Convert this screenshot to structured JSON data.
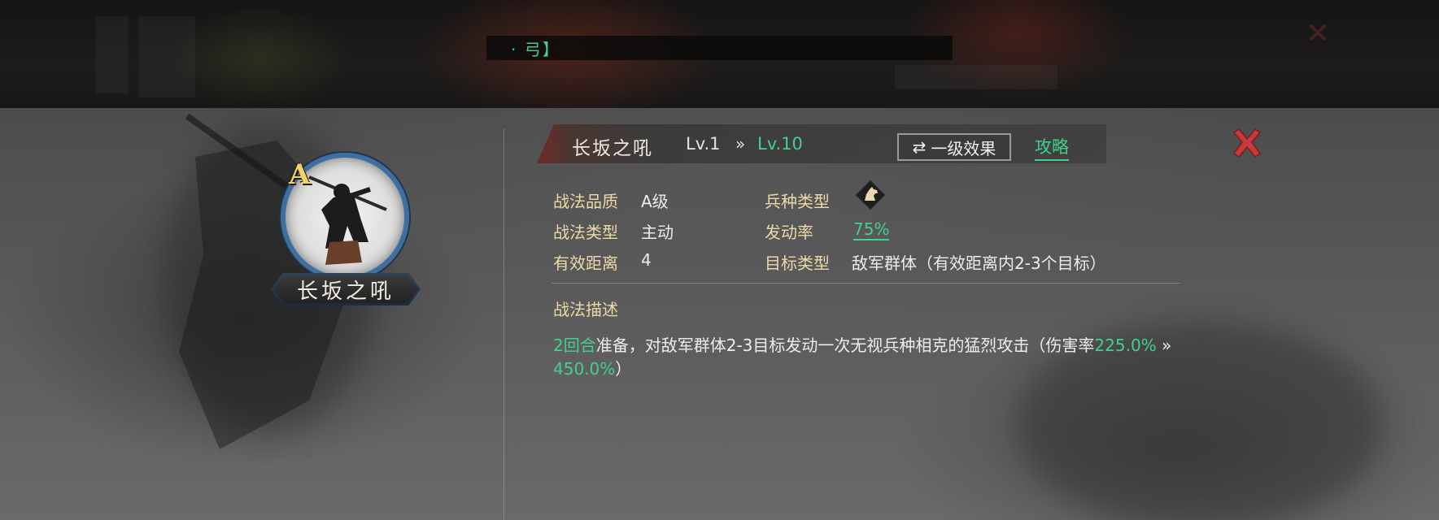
{
  "background_header": {
    "title": "· 弓】"
  },
  "skill": {
    "grade_badge": "A",
    "name": "长坂之吼",
    "level_from": "Lv.1",
    "level_arrow": "»",
    "level_to": "Lv.10"
  },
  "header": {
    "level_toggle_label": "一级效果",
    "guide_label": "攻略"
  },
  "attributes": {
    "quality_label": "战法品质",
    "quality_value": "A级",
    "type_label": "战法类型",
    "type_value": "主动",
    "range_label": "有效距离",
    "range_value": "4",
    "troop_label": "兵种类型",
    "troop_icon": "cavalry-horse-icon",
    "rate_label": "发动率",
    "rate_value": "75%",
    "target_label": "目标类型",
    "target_value": "敌军群体（有效距离内2-3个目标）"
  },
  "description": {
    "title": "战法描述",
    "part1": "2回合",
    "part2": "准备，对敌军群体2-3目标发动一次无视兵种相克的猛烈攻击（伤害率",
    "part3": "225.0%",
    "part4": " » ",
    "part5": "450.0%",
    "part6": "）"
  },
  "colors": {
    "accent_green": "#43d08d",
    "label_gold": "#ecd9a8",
    "close_red": "#c8393a",
    "badge_gold": "#f3d26b",
    "ring_blue": "#3f6f9f"
  }
}
